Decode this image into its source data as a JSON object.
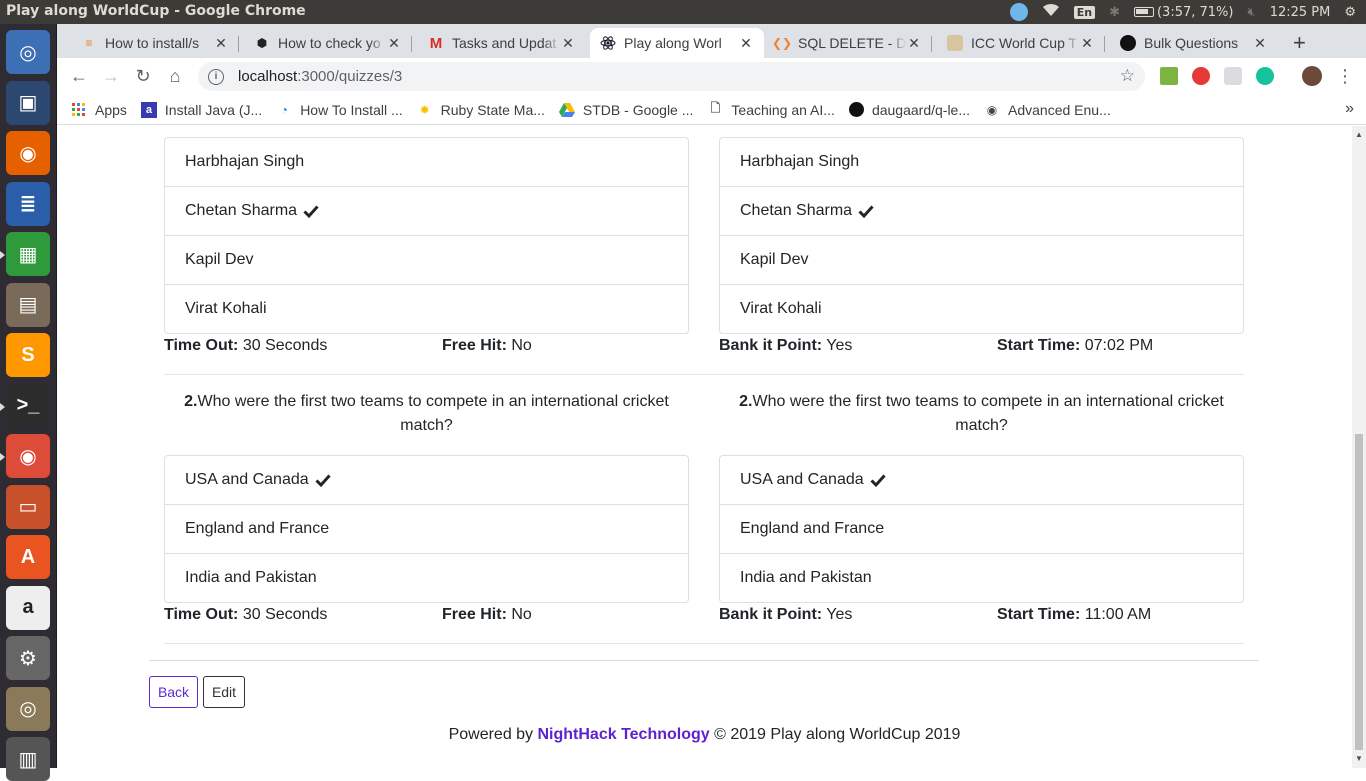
{
  "system": {
    "window_title": "Play along WorldCup - Google Chrome",
    "battery": "(3:57, 71%)",
    "keyboard": "En",
    "clock": "12:25 PM"
  },
  "launcher": {
    "items": [
      {
        "name": "ubuntu-dash",
        "color": "#3d6fb5"
      },
      {
        "name": "workspace-switcher",
        "color": "#2c4770"
      },
      {
        "name": "firefox",
        "color": "#e66000"
      },
      {
        "name": "libreoffice-writer",
        "color": "#2a5ea8"
      },
      {
        "name": "libreoffice-calc",
        "color": "#2e9a3c"
      },
      {
        "name": "files",
        "color": "#7a6a5a"
      },
      {
        "name": "sublime-text",
        "color": "#ff9800"
      },
      {
        "name": "terminal",
        "color": "#2c2c2c"
      },
      {
        "name": "chrome",
        "color": "#dd4b39"
      },
      {
        "name": "libreoffice-impress",
        "color": "#c8502a"
      },
      {
        "name": "ubuntu-software",
        "color": "#e95420"
      },
      {
        "name": "amazon",
        "color": "#eeeeee"
      },
      {
        "name": "system-settings",
        "color": "#666666"
      },
      {
        "name": "disk",
        "color": "#8a7a5a"
      },
      {
        "name": "trash",
        "color": "#555555"
      }
    ]
  },
  "tabs": [
    {
      "title": "How to install/s",
      "active": false
    },
    {
      "title": "How to check yo",
      "active": false
    },
    {
      "title": "Tasks and Updat",
      "active": false
    },
    {
      "title": "Play along Worl",
      "active": true
    },
    {
      "title": "SQL DELETE - De",
      "active": false
    },
    {
      "title": "ICC World Cup T",
      "active": false
    },
    {
      "title": "Bulk Questions",
      "active": false
    }
  ],
  "address": {
    "host": "localhost",
    "path": ":3000/quizzes/3"
  },
  "bookmarks": [
    {
      "label": "Apps"
    },
    {
      "label": "Install Java (J..."
    },
    {
      "label": "How To Install ..."
    },
    {
      "label": "Ruby State Ma..."
    },
    {
      "label": "STDB - Google ..."
    },
    {
      "label": "Teaching an AI..."
    },
    {
      "label": "daugaard/q-le..."
    },
    {
      "label": "Advanced Enu..."
    }
  ],
  "quiz": {
    "labels": {
      "timeout": "Time Out:",
      "freehit": "Free Hit:",
      "bank": "Bank it Point:",
      "start": "Start Time:"
    },
    "question1": {
      "options": [
        {
          "text": "Harbhajan Singh",
          "correct": false
        },
        {
          "text": "Chetan Sharma",
          "correct": true
        },
        {
          "text": "Kapil Dev",
          "correct": false
        },
        {
          "text": "Virat Kohali",
          "correct": false
        }
      ],
      "left_meta": {
        "timeout": "30 Seconds",
        "freehit": "No"
      },
      "right_meta": {
        "bank": "Yes",
        "start": "07:02 PM"
      }
    },
    "question2": {
      "number": "2.",
      "text": "Who were the first two teams to compete in an international cricket match?",
      "options": [
        {
          "text": "USA and Canada",
          "correct": true
        },
        {
          "text": "England and France",
          "correct": false
        },
        {
          "text": "India and Pakistan",
          "correct": false
        }
      ],
      "left_meta": {
        "timeout": "30 Seconds",
        "freehit": "No"
      },
      "right_meta": {
        "bank": "Yes",
        "start": "11:00 AM"
      }
    }
  },
  "actions": {
    "back": "Back",
    "edit": "Edit"
  },
  "footer": {
    "prefix": "Powered by ",
    "brand": "NightHack Technology",
    "suffix": " © 2019 Play along WorldCup 2019"
  }
}
